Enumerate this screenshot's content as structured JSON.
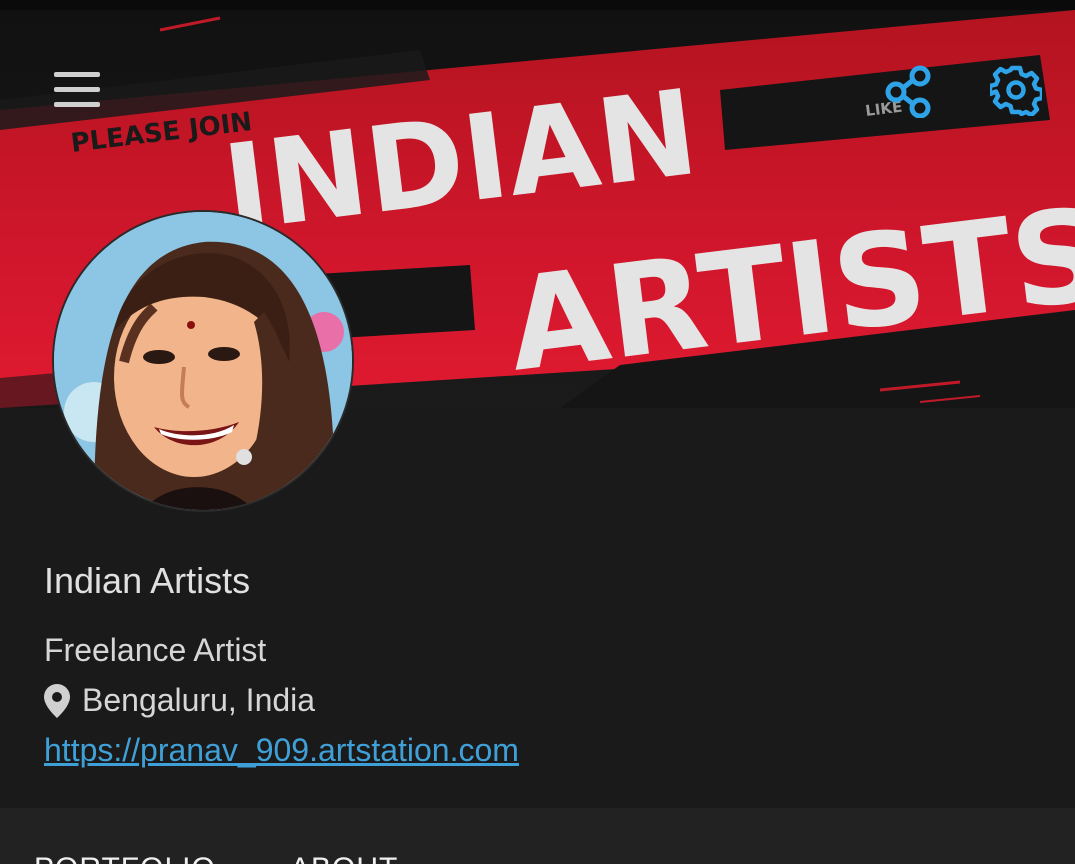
{
  "banner": {
    "please_join": "PLEASE JOIN",
    "title_line1": "INDIAN",
    "title_line2": "ARTISTS",
    "like_text": "LIKE",
    "background_color": "#d0162c",
    "title_color": "#e4e4e4"
  },
  "header": {
    "menu_icon": "hamburger-menu-icon",
    "share_icon": "share-icon",
    "settings_icon": "gear-icon",
    "accent_color": "#2ea3e8"
  },
  "profile": {
    "name": "Indian Artists",
    "headline": "Freelance Artist",
    "location": "Bengaluru, India",
    "location_icon": "map-pin-icon",
    "website": "https://pranav_909.artstation.com",
    "link_color": "#3fa0d8"
  },
  "tabs": [
    {
      "label": "PORTFOLIO"
    },
    {
      "label": "ABOUT"
    }
  ]
}
